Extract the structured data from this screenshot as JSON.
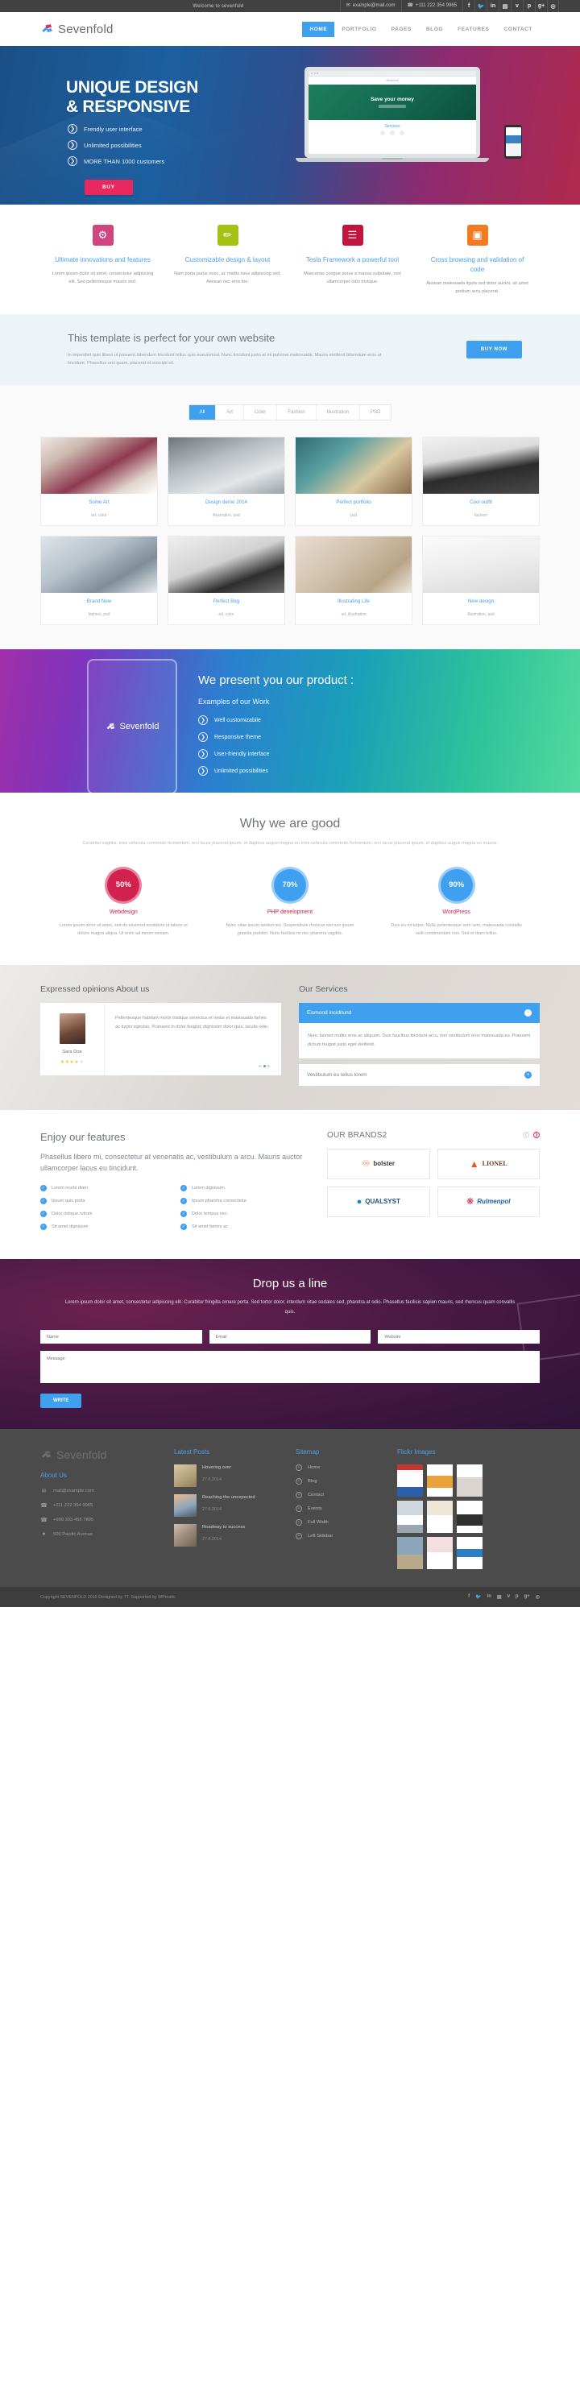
{
  "topbar": {
    "left_text": "Welcome to sevenfold",
    "welcome": "Welcome to sevenfold",
    "email": "example@mail.com",
    "phone": "+111 222 354 9965",
    "socials": [
      "f",
      "t",
      "in",
      "b",
      "v",
      "p",
      "g+",
      "rss"
    ]
  },
  "header": {
    "brand": "Sevenfold",
    "nav": [
      {
        "label": "HOME",
        "active": true
      },
      {
        "label": "PORTFOLIO",
        "active": false
      },
      {
        "label": "PAGES",
        "active": false
      },
      {
        "label": "BLOG",
        "active": false
      },
      {
        "label": "FEATURES",
        "active": false
      },
      {
        "label": "CONTACT",
        "active": false
      }
    ]
  },
  "hero": {
    "title_line1": "UNIQUE DESIGN",
    "title_line2": "& RESPONSIVE",
    "bullets": [
      "Frendly user interface",
      "Unlimited possibilities",
      "MORE THAN 1000 customers"
    ],
    "button": "BUY",
    "laptop": {
      "browser_title": "Sevenfold",
      "banner": "Save your money",
      "services": "Services"
    }
  },
  "features": [
    {
      "icon": "gear-icon",
      "glyph": "⚙",
      "color": "#d1457e",
      "title": "Ultimate innovations and features",
      "text": "Lorem ipsum dolor sit amet, consectetur adipiscing elit. Sed pellentesque mauris sed."
    },
    {
      "icon": "ruler-pencil-icon",
      "glyph": "✎",
      "color": "#a4c114",
      "title": "Customizable design & layout",
      "text": "Nam porta purus nunc, ac mattis risus adipiscing sed. Aenean nec eros leo."
    },
    {
      "icon": "sliders-icon",
      "glyph": "⚙",
      "color": "#c2143f",
      "title": "Tesla Framework a powerful tool",
      "text": "Maecenas congue purus a massa vulputate, non ullamcorper odio tristique."
    },
    {
      "icon": "monitor-icon",
      "glyph": "▣",
      "color": "#f07b21",
      "title": "Cross browsing and validation of code",
      "text": "Aenean malesuada ligula sed dolor auctor, sit amet pretium arcu placerat."
    }
  ],
  "cta": {
    "title": "This template is perfect for your own website",
    "text": "In imperdiet quis libero ut posuent bibendum tincidunt tellus quis eueuismod. Nunc tincidunt justo at mi pulvinar malesuada. Mauris eleifend bibendum eros ut tincidunt. Phasellus orci quam, placerat et suscipit sit.",
    "button": "BUY NOW"
  },
  "portfolio": {
    "filters": [
      {
        "label": "All",
        "active": true
      },
      {
        "label": "Art",
        "active": false
      },
      {
        "label": "Color",
        "active": false
      },
      {
        "label": "Fashion",
        "active": false
      },
      {
        "label": "Illustration",
        "active": false
      },
      {
        "label": "PSD",
        "active": false
      }
    ],
    "items": [
      {
        "title": "Some Art",
        "tags": "art, color"
      },
      {
        "title": "Design demo 2014",
        "tags": "illustration, psd"
      },
      {
        "title": "Perfect portfolio",
        "tags": "psd"
      },
      {
        "title": "Cool outfit",
        "tags": "fashion"
      },
      {
        "title": "Brand New",
        "tags": "fashion, psd"
      },
      {
        "title": "Perfect Bag",
        "tags": "art, color"
      },
      {
        "title": "Illustrating Life",
        "tags": "art, illustration"
      },
      {
        "title": "New design",
        "tags": "illustration, psd"
      }
    ]
  },
  "product": {
    "brand": "Sevenfold",
    "title": "We present you our product :",
    "subtitle": "Examples of our Work",
    "bullets": [
      "Well customizabile",
      "Responsive theme",
      "User-friendly interface",
      "Unlimited possibilities"
    ]
  },
  "why": {
    "title": "Why we are good",
    "text": "Curabitur sagittis, eros vehicula commodo fermentum, orci lacus placerat ipsum, et dapibus augue magna eu eros vehicula commodo fermentum, orci lacus placerat ipsum, et dapibus augue magna eu massa.",
    "stats": [
      {
        "value": "50%",
        "label": "Webdesign",
        "color": "#d1224f",
        "ring": "#e8849f",
        "text": "Lorem ipsum dolor sit amet, sed do eiusmod incididunt ut labore et dolore magna aliqua. Ut enim ad minim veniam."
      },
      {
        "value": "70%",
        "label": "PHP development",
        "color": "#3fa0ef",
        "ring": "#9ccdf6",
        "text": "Nunc vitae ipsum laoreet leo. Suspendisse rhoncus nisi non ipsum gravida porttitor. Nunc facilisis mi nec pharetra sagittis."
      },
      {
        "value": "90%",
        "label": "WordPress",
        "color": "#3fa0ef",
        "ring": "#9ccdf6",
        "text": "Duis eu mi turpis. Nulla pellentesque sem sem, malesuada convallis velit condimentum non. Sed et diam tellus."
      }
    ]
  },
  "testimonials": {
    "title": "Expressed opinions About us",
    "author": "Sara Doe",
    "stars_filled": 4,
    "stars_total": 5,
    "text": "Pellentesque habitant morbi tristique senectus et netus et malesuada fames ac turpis egestas. Praesent in dolor feugiat, dignissim dolor quis, iaculis odio.",
    "dots": 3,
    "active_dot": 2
  },
  "services": {
    "title": "Our Services",
    "open_item": "Eismond inciditund",
    "open_body": "Nunc laoreet mattis eros ac aliquam. Duis faucibus tincidunt arcu, non vestibulum eros malesuada eu. Praesent dictum feugiat justo eget eleifend.",
    "closed_item": "Vestibulum eu tellus lorem"
  },
  "enjoy": {
    "title": "Enjoy our features",
    "lead": "Phasellus libero mi, consectetur at venenatis ac, vestibulum a arcu. Mauris auctor ullamcorper lacus eu tincidunt.",
    "col1": [
      "Lorem morbi diam",
      "Ipsum quis porta",
      "Dolor ristique rutrum",
      "Sit amet dignissim"
    ],
    "col2": [
      "Lorem dignissim",
      "Ipsum pharetra consectetur",
      "Dolor tempus nec",
      "Sit amet fames ac"
    ],
    "brands_title": "OUR BRANDS2",
    "brands": [
      {
        "name": "bolster",
        "color": "#f26522"
      },
      {
        "name": "LIONEL",
        "color": "#e8561d"
      },
      {
        "name": "QUALSYST",
        "color": "#1f4e79"
      },
      {
        "name": "Rulmenpol",
        "color": "#1f5fa8"
      }
    ]
  },
  "contact": {
    "title": "Drop us a line",
    "text": "Lorem ipsum dolor sit amet, consectetur adipiscing elit. Curabitur fringilla ornare porta. Sed tortor dolor, interdum vitae sodales sed, pharetra at odio. Phasellus facilisis sapien mauris, sed rhoncus quam convallis quis.",
    "name_placeholder": "Name",
    "email_placeholder": "Email",
    "website_placeholder": "Website",
    "message_placeholder": "Message",
    "button": "WRITE"
  },
  "footer": {
    "brand": "Sevenfold",
    "about_title": "About Us",
    "contacts": [
      {
        "icon": "mail-icon",
        "glyph": "✉",
        "text": "mail@example.com"
      },
      {
        "icon": "phone-icon",
        "glyph": "☎",
        "text": "+111 222 354 9965"
      },
      {
        "icon": "phone-icon",
        "glyph": "☎",
        "text": "+999 333 458 7895"
      },
      {
        "icon": "pin-icon",
        "glyph": "●",
        "text": "500 Pacific Avenue"
      }
    ],
    "posts_title": "Latest Posts",
    "posts": [
      {
        "title": "Hovering over",
        "date": "27.6.2014"
      },
      {
        "title": "Reaching the unexpected",
        "date": "27.6.2014"
      },
      {
        "title": "Roadway to success",
        "date": "27.6.2014"
      }
    ],
    "sitemap_title": "Sitemap",
    "sitemap": [
      "Home",
      "Blog",
      "Contact",
      "Events",
      "Full Width",
      "Left Sidebar"
    ],
    "flickr_title": "Flickr Images",
    "flickr_count": 9,
    "copyright": "Copyright SEVENFOLD 2015 Designed by TT. Supported by WPmatic",
    "socials": [
      "f",
      "t",
      "in",
      "b",
      "v",
      "p",
      "g+",
      "rss"
    ]
  }
}
